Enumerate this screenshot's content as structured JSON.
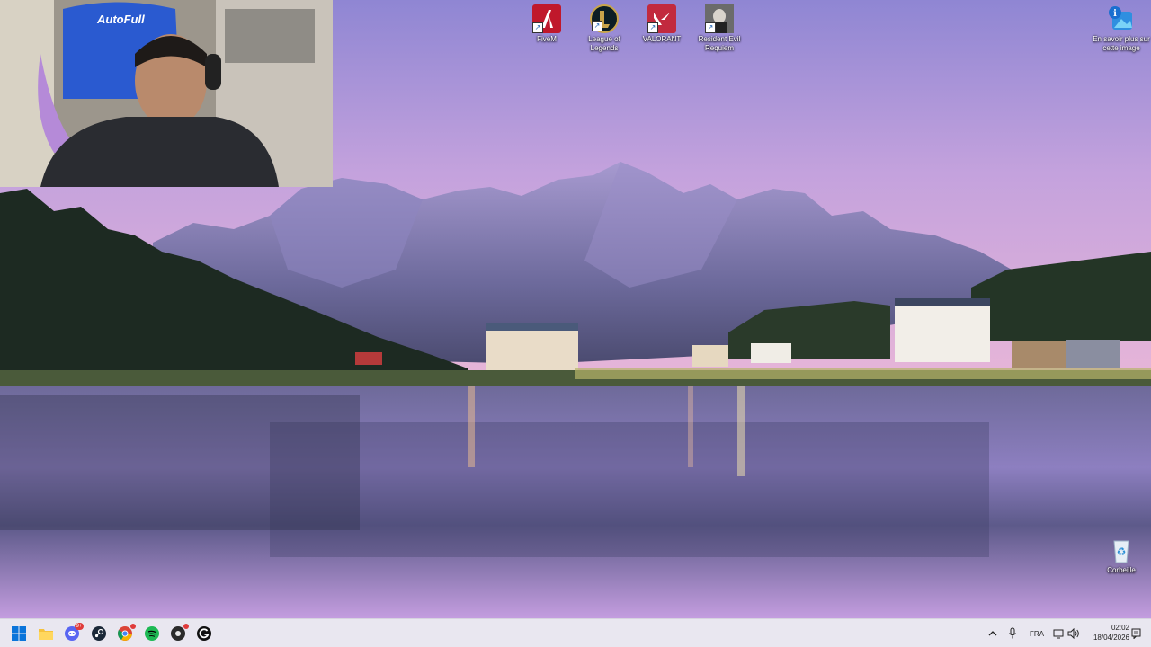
{
  "desktop": {
    "icons": [
      {
        "label": "FiveM",
        "icon": "fivem-icon",
        "color": "#c0182b"
      },
      {
        "label": "League of Legends",
        "icon": "league-of-legends-icon",
        "color": "#0b1e24"
      },
      {
        "label": "VALORANT",
        "icon": "valorant-icon",
        "color": "#c22a3e"
      },
      {
        "label": "Resident Evil Requiem",
        "icon": "resident-evil-requiem-icon",
        "color": "#3a3a3a"
      }
    ],
    "spotlight": {
      "label": "En savoir plus sur cette image",
      "icon": "info-camera-icon"
    },
    "recycle_bin": {
      "label": "Corbeille",
      "icon": "recycle-bin-icon"
    }
  },
  "webcam": {
    "chair_brand": "AutoFull"
  },
  "taskbar": {
    "apps": [
      {
        "name": "start",
        "icon": "windows-start-icon"
      },
      {
        "name": "file-explorer",
        "icon": "folder-icon"
      },
      {
        "name": "discord",
        "icon": "discord-icon",
        "badge": "9+"
      },
      {
        "name": "steam",
        "icon": "steam-icon"
      },
      {
        "name": "chrome",
        "icon": "chrome-icon"
      },
      {
        "name": "spotify",
        "icon": "spotify-icon"
      },
      {
        "name": "app-red-dot",
        "icon": "app-icon"
      },
      {
        "name": "g-hub",
        "icon": "g-icon"
      }
    ],
    "tray": {
      "language": "FRA",
      "time": "02:02",
      "date": "18/04/2026"
    }
  }
}
